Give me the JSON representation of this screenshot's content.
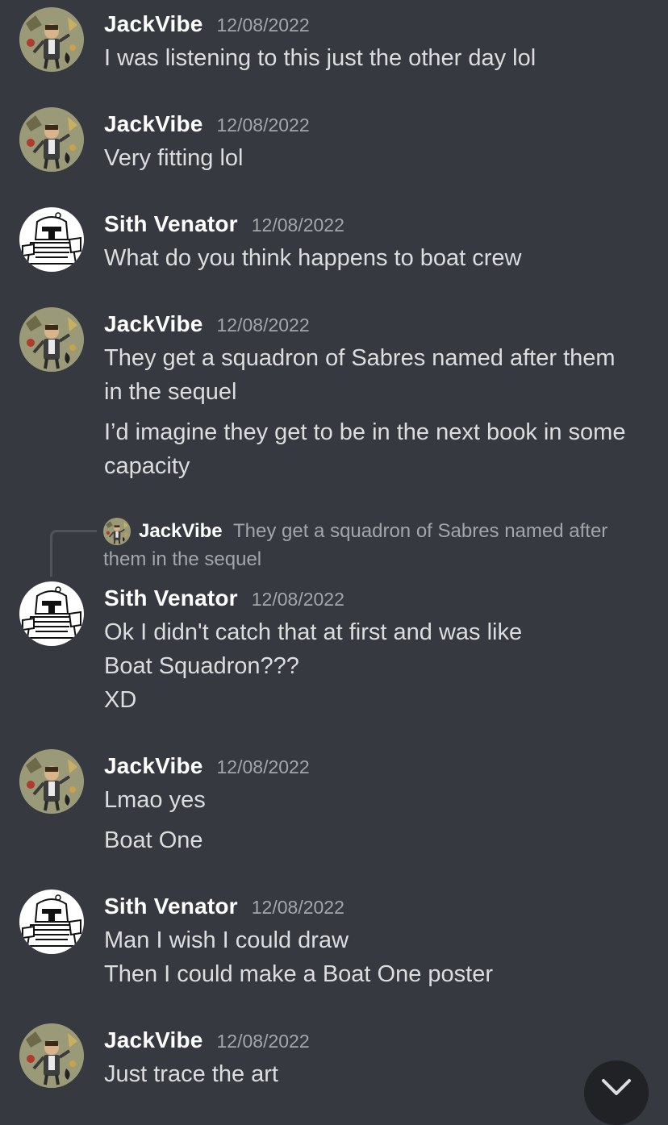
{
  "messages": [
    {
      "author": "JackVibe",
      "avatar_icon": "jackvibe-avatar",
      "timestamp": "12/08/2022",
      "lines": [
        "I was listening to this just the other day lol"
      ]
    },
    {
      "author": "JackVibe",
      "avatar_icon": "jackvibe-avatar",
      "timestamp": "12/08/2022",
      "lines": [
        "Very fitting lol"
      ]
    },
    {
      "author": "Sith Venator",
      "avatar_icon": "sith-venator-avatar",
      "timestamp": "12/08/2022",
      "lines": [
        "What do you think happens to boat crew"
      ]
    },
    {
      "author": "JackVibe",
      "avatar_icon": "jackvibe-avatar",
      "timestamp": "12/08/2022",
      "lines": [
        "They get a squadron of Sabres named after them",
        "in the sequel",
        "I’d imagine they get to be in the next book in some",
        "capacity"
      ]
    },
    {
      "reply_to": {
        "author": "JackVibe",
        "text_line1": "They get a squadron of Sabres named after",
        "text_line2": "them in the sequel"
      },
      "author": "Sith Venator",
      "avatar_icon": "sith-venator-avatar",
      "timestamp": "12/08/2022",
      "lines": [
        "Ok I didn't catch that at first and was like",
        "Boat Squadron???",
        "XD"
      ]
    },
    {
      "author": "JackVibe",
      "avatar_icon": "jackvibe-avatar",
      "timestamp": "12/08/2022",
      "lines": [
        "Lmao yes",
        "Boat One"
      ]
    },
    {
      "author": "Sith Venator",
      "avatar_icon": "sith-venator-avatar",
      "timestamp": "12/08/2022",
      "lines": [
        "Man I wish I could draw",
        "Then I could make a Boat One poster"
      ]
    },
    {
      "author": "JackVibe",
      "avatar_icon": "jackvibe-avatar",
      "timestamp": "12/08/2022",
      "lines": [
        "Just trace the art"
      ]
    }
  ],
  "jump_button_icon": "chevron-down-icon",
  "colors": {
    "background": "#36393f",
    "username": "#ffffff",
    "timestamp": "#a3a6aa",
    "message_text": "#dcddde",
    "jump_button": "#202225"
  }
}
